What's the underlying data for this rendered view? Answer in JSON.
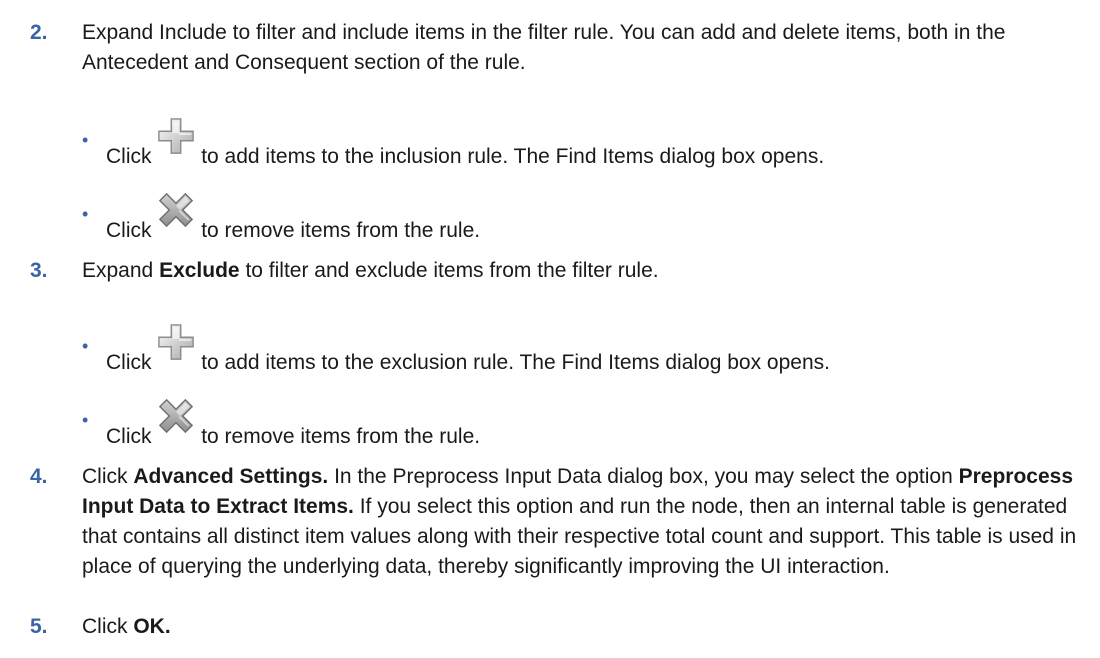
{
  "steps": [
    {
      "number": "2.",
      "parts": [
        "Expand Include to filter and include items in the filter rule. You can add and delete items, both in the Antecedent and Consequent section of the rule."
      ]
    },
    {
      "number": "3.",
      "parts": [
        "Expand ",
        "Exclude",
        " to filter and exclude items from the filter rule."
      ]
    },
    {
      "number": "4.",
      "parts": [
        "Click ",
        "Advanced Settings.",
        " In the Preprocess Input Data dialog box, you may select the option ",
        "Preprocess Input Data to Extract Items.",
        " If you select this option and run the node, then an internal table is generated that contains all distinct item values along with their respective total count and support. This table is used in place of querying the underlying data, thereby significantly improving the UI interaction."
      ]
    },
    {
      "number": "5.",
      "parts": [
        "Click ",
        "OK."
      ]
    }
  ],
  "bullets": [
    {
      "marker": "•",
      "before": "Click",
      "icon": "plus-icon",
      "after": "to add items to the inclusion rule. The Find Items dialog box opens."
    },
    {
      "marker": "•",
      "before": "Click",
      "icon": "remove-x-icon",
      "after": "to remove items from the rule."
    },
    {
      "marker": "•",
      "before": "Click",
      "icon": "plus-icon",
      "after": "to add items to the exclusion rule. The Find Items dialog box opens."
    },
    {
      "marker": "•",
      "before": "Click",
      "icon": "remove-x-icon",
      "after": "to remove items from the rule."
    }
  ],
  "colors": {
    "step_number": "#3a63a8",
    "bullet": "#3a63a8",
    "text": "#1a1a1a"
  }
}
